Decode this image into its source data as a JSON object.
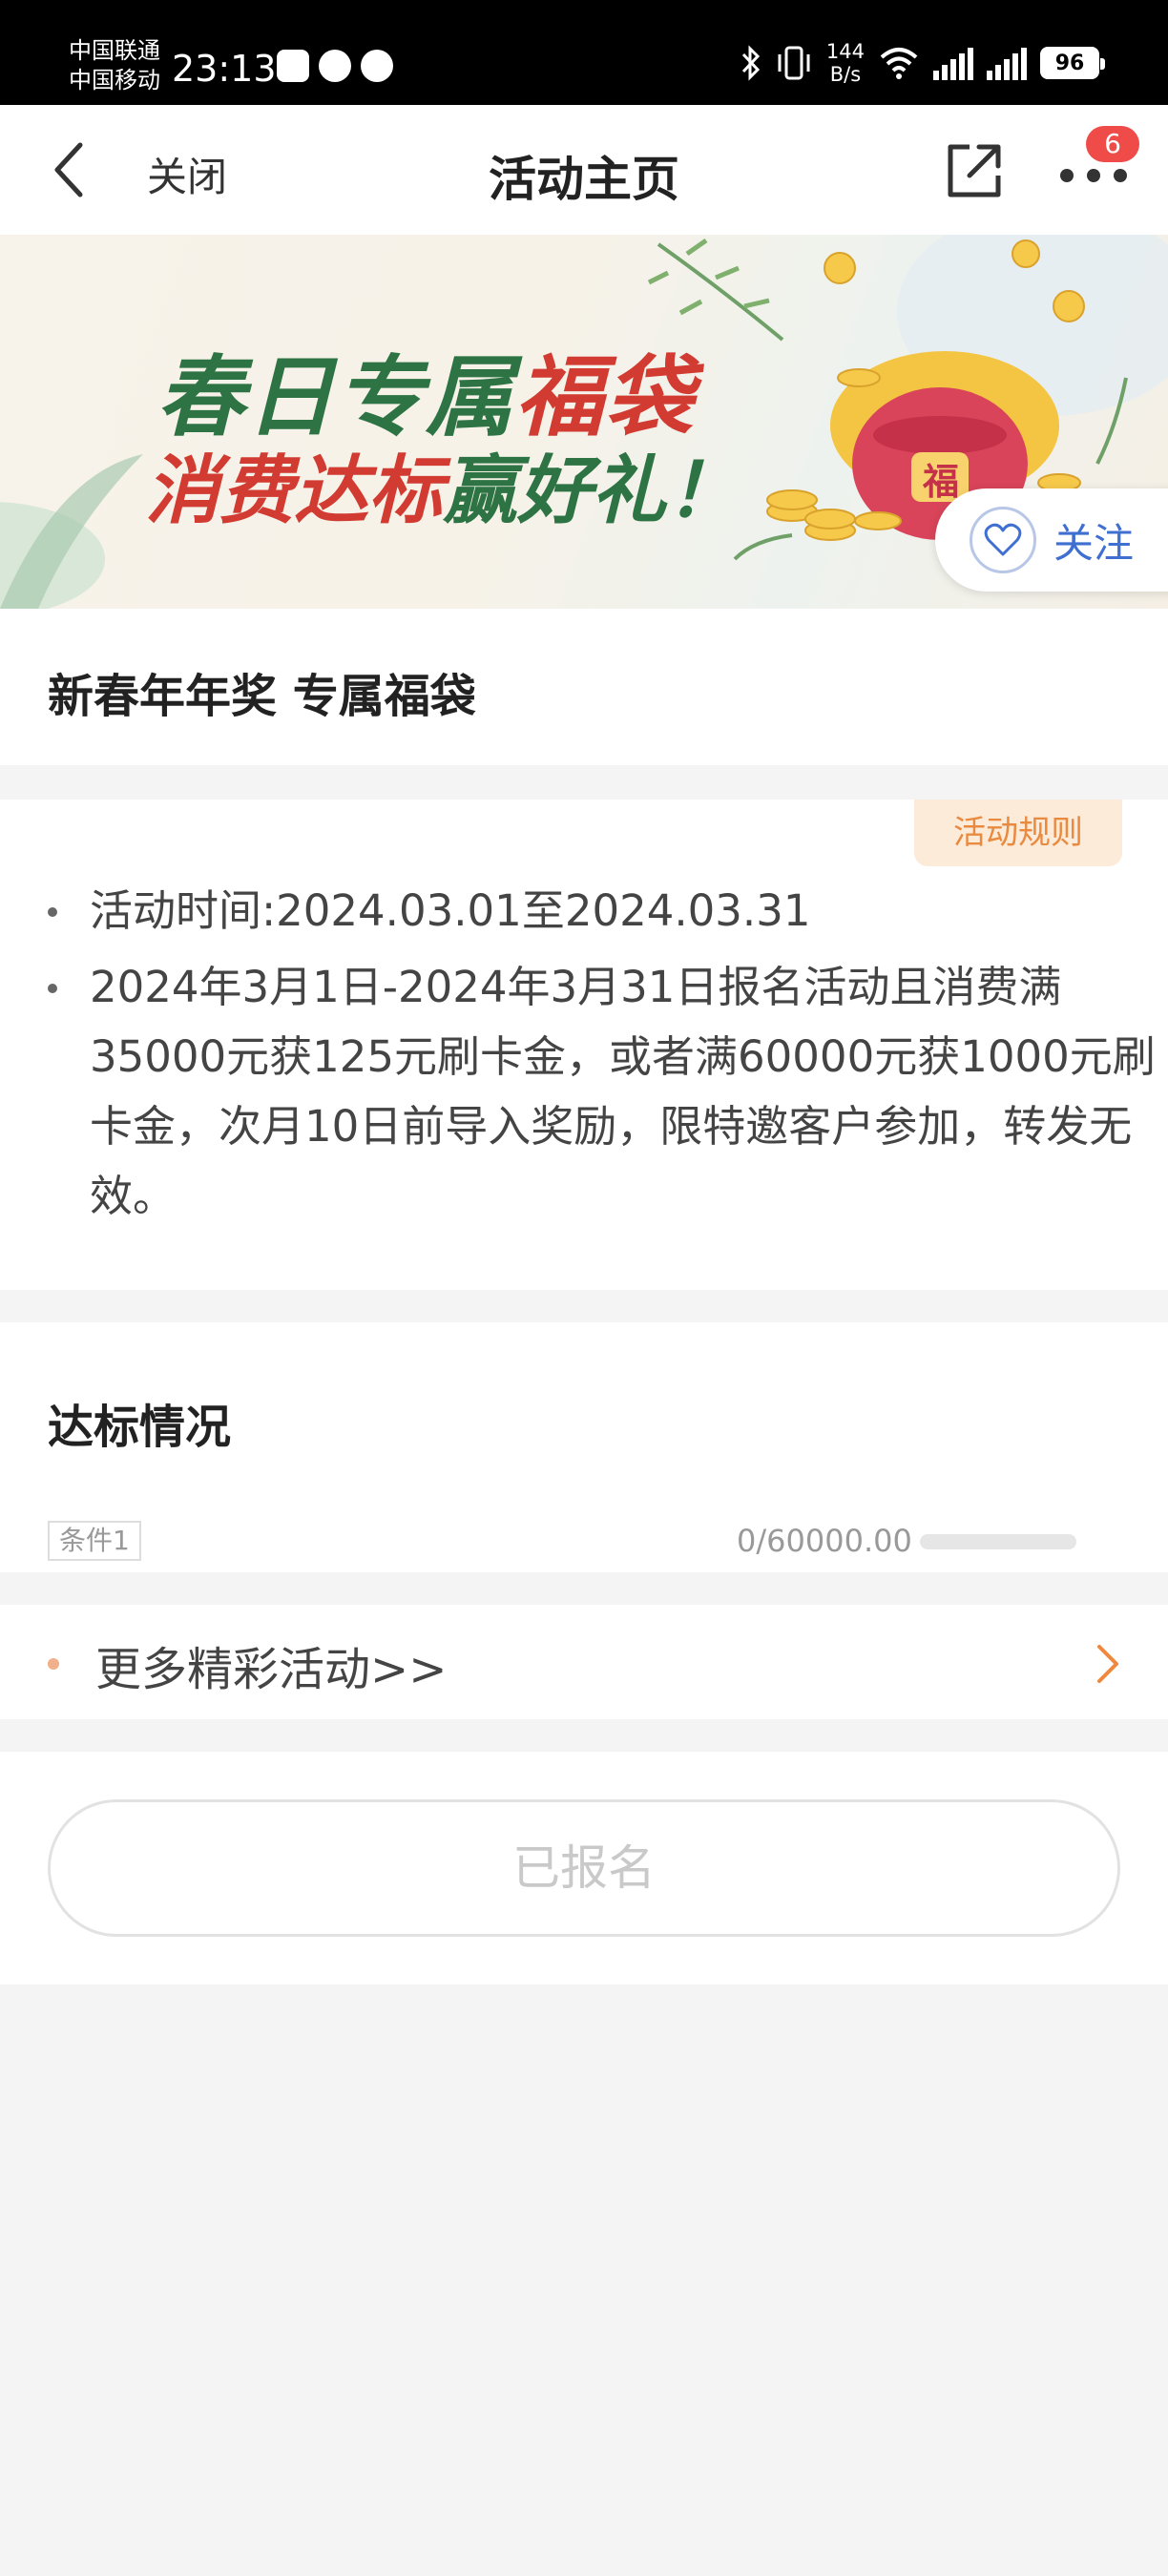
{
  "status_bar": {
    "carrier_1": "中国联通",
    "carrier_2": "中国移动",
    "time": "23:13",
    "net_speed_value": "144",
    "net_speed_unit": "B/s",
    "battery": "96"
  },
  "nav": {
    "close_label": "关闭",
    "title": "活动主页",
    "more_badge": "6"
  },
  "banner": {
    "line1_a": "春日专属",
    "line1_b": "福袋",
    "line2_a": "消费达标",
    "line2_b": "赢好礼！",
    "bag_char": "福",
    "follow_label": "关注"
  },
  "activity": {
    "title": "新春年年奖 专属福袋"
  },
  "rules": {
    "button_label": "活动规则",
    "items": [
      "活动时间:2024.03.01至2024.03.31",
      "2024年3月1日-2024年3月31日报名活动且消费满35000元获125元刷卡金，或者满60000元获1000元刷卡金，次月10日前导入奖励，限特邀客户参加，转发无效。"
    ]
  },
  "progress": {
    "heading": "达标情况",
    "condition_label": "条件1",
    "value_text": "0/60000.00",
    "fraction": 0
  },
  "more_activities": {
    "label": "更多精彩活动>>"
  },
  "register": {
    "label": "已报名"
  },
  "colors": {
    "accent_orange": "#f0883e",
    "banner_green": "#2d7344",
    "banner_red": "#d23b31",
    "follow_blue": "#3f6fd1",
    "badge_red": "#ef4b48"
  }
}
